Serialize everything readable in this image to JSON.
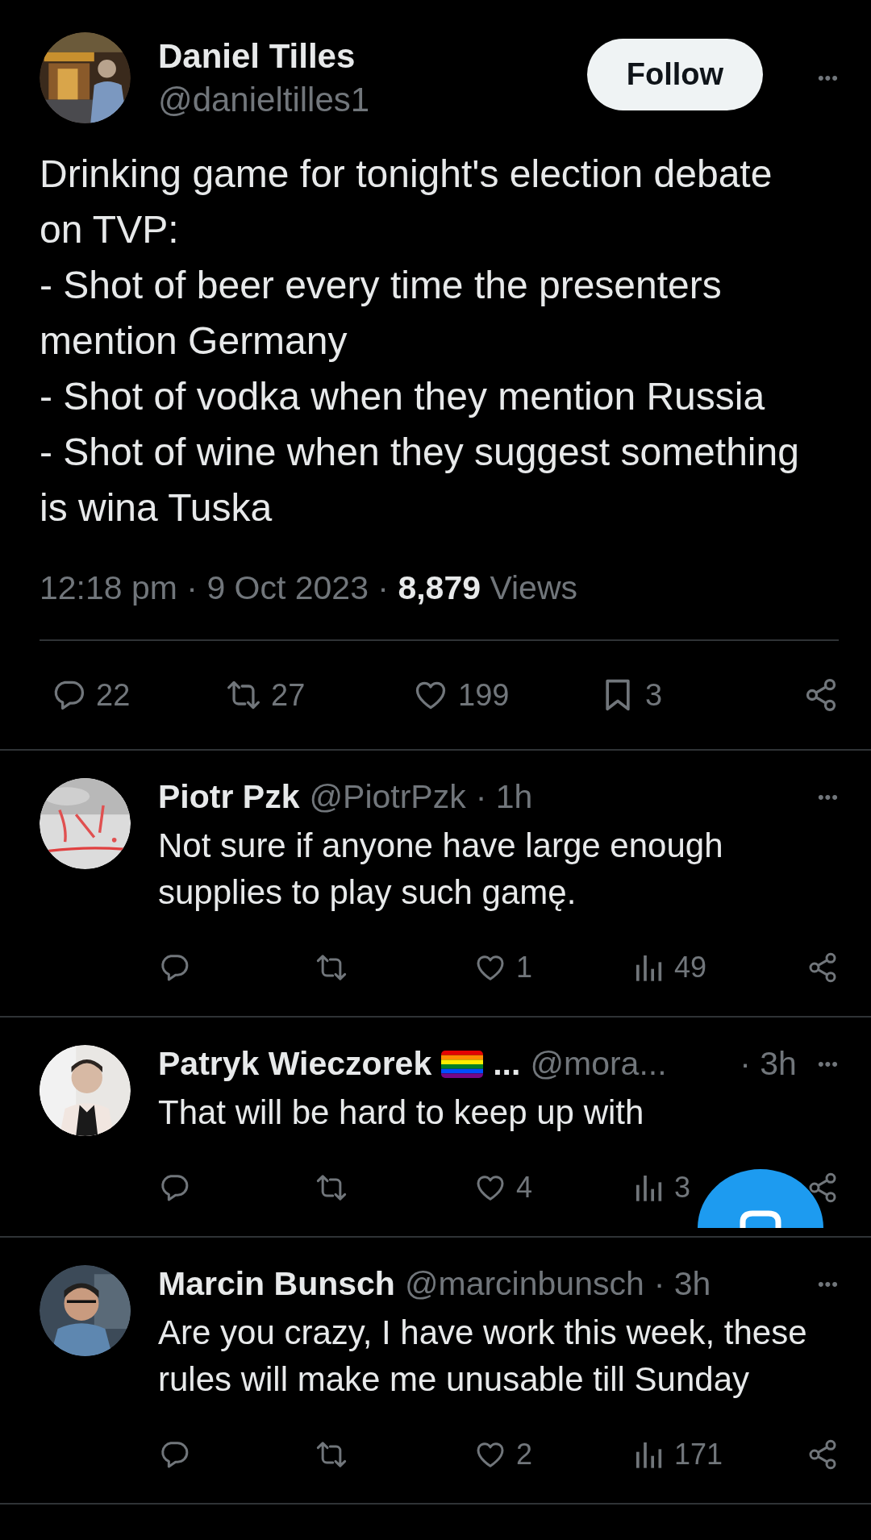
{
  "tweet": {
    "author": {
      "name": "Daniel Tilles",
      "handle": "@danieltilles1"
    },
    "follow_button": "Follow",
    "more": "•••",
    "text_lines": [
      "Drinking game for tonight's election debate",
      "on TVP:",
      "- Shot of beer every time the presenters",
      "mention Germany",
      "- Shot of vodka when they mention Russia",
      "- Shot of wine when they suggest something",
      "is wina Tuska"
    ],
    "meta": "12:18 pm · 9 Oct 2023 · **8,879** Views",
    "actions": [
      {
        "kind": "reply",
        "count": "22"
      },
      {
        "kind": "retweet",
        "count": "27"
      },
      {
        "kind": "like",
        "count": "199"
      },
      {
        "kind": "bookmark",
        "count": "3"
      },
      {
        "kind": "share"
      }
    ]
  },
  "replies": [
    {
      "name": "Piotr Pzk",
      "handle": "@PiotrPzk",
      "time": "· 1h",
      "text": "Not sure if anyone have large enough supplies to play such gamę.",
      "actions": [
        {
          "kind": "reply"
        },
        {
          "kind": "retweet"
        },
        {
          "kind": "like",
          "count": "1"
        },
        {
          "kind": "views",
          "count": "49"
        },
        {
          "kind": "share"
        }
      ]
    },
    {
      "name": "Patryk Wieczorek",
      "flag": true,
      "name_tail": "...",
      "handle": "@mora...",
      "time": "· 3h",
      "text": "That will be hard to keep up with",
      "actions": [
        {
          "kind": "reply"
        },
        {
          "kind": "retweet"
        },
        {
          "kind": "like",
          "count": "4"
        },
        {
          "kind": "views",
          "count": "3"
        },
        {
          "kind": "share"
        }
      ]
    },
    {
      "name": "Marcin Bunsch",
      "handle": "@marcinbunsch",
      "time": "· 3h",
      "text": "Are you crazy, I have work this week, these rules will make me unusable till Sunday",
      "actions": [
        {
          "kind": "reply"
        },
        {
          "kind": "retweet"
        },
        {
          "kind": "like",
          "count": "2"
        },
        {
          "kind": "views",
          "count": "171"
        },
        {
          "kind": "share"
        }
      ]
    }
  ]
}
